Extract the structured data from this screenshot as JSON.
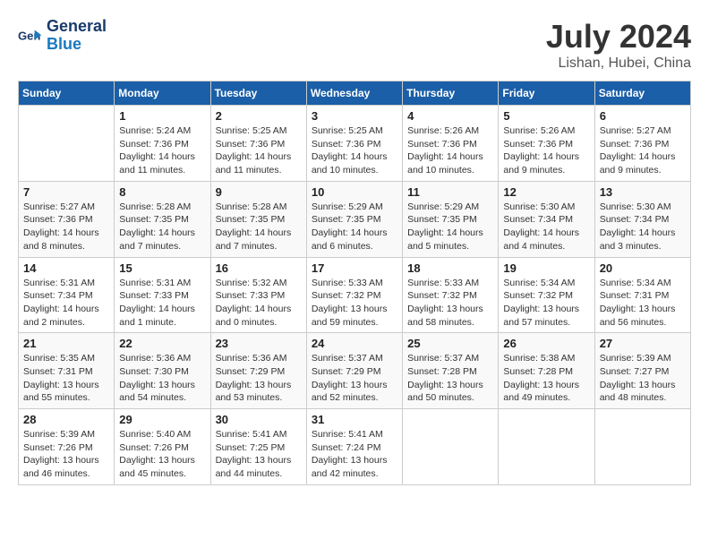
{
  "header": {
    "logo_line1": "General",
    "logo_line2": "Blue",
    "month_title": "July 2024",
    "location": "Lishan, Hubei, China"
  },
  "days_of_week": [
    "Sunday",
    "Monday",
    "Tuesday",
    "Wednesday",
    "Thursday",
    "Friday",
    "Saturday"
  ],
  "weeks": [
    [
      {
        "day": "",
        "info": ""
      },
      {
        "day": "1",
        "info": "Sunrise: 5:24 AM\nSunset: 7:36 PM\nDaylight: 14 hours\nand 11 minutes."
      },
      {
        "day": "2",
        "info": "Sunrise: 5:25 AM\nSunset: 7:36 PM\nDaylight: 14 hours\nand 11 minutes."
      },
      {
        "day": "3",
        "info": "Sunrise: 5:25 AM\nSunset: 7:36 PM\nDaylight: 14 hours\nand 10 minutes."
      },
      {
        "day": "4",
        "info": "Sunrise: 5:26 AM\nSunset: 7:36 PM\nDaylight: 14 hours\nand 10 minutes."
      },
      {
        "day": "5",
        "info": "Sunrise: 5:26 AM\nSunset: 7:36 PM\nDaylight: 14 hours\nand 9 minutes."
      },
      {
        "day": "6",
        "info": "Sunrise: 5:27 AM\nSunset: 7:36 PM\nDaylight: 14 hours\nand 9 minutes."
      }
    ],
    [
      {
        "day": "7",
        "info": "Sunrise: 5:27 AM\nSunset: 7:36 PM\nDaylight: 14 hours\nand 8 minutes."
      },
      {
        "day": "8",
        "info": "Sunrise: 5:28 AM\nSunset: 7:35 PM\nDaylight: 14 hours\nand 7 minutes."
      },
      {
        "day": "9",
        "info": "Sunrise: 5:28 AM\nSunset: 7:35 PM\nDaylight: 14 hours\nand 7 minutes."
      },
      {
        "day": "10",
        "info": "Sunrise: 5:29 AM\nSunset: 7:35 PM\nDaylight: 14 hours\nand 6 minutes."
      },
      {
        "day": "11",
        "info": "Sunrise: 5:29 AM\nSunset: 7:35 PM\nDaylight: 14 hours\nand 5 minutes."
      },
      {
        "day": "12",
        "info": "Sunrise: 5:30 AM\nSunset: 7:34 PM\nDaylight: 14 hours\nand 4 minutes."
      },
      {
        "day": "13",
        "info": "Sunrise: 5:30 AM\nSunset: 7:34 PM\nDaylight: 14 hours\nand 3 minutes."
      }
    ],
    [
      {
        "day": "14",
        "info": "Sunrise: 5:31 AM\nSunset: 7:34 PM\nDaylight: 14 hours\nand 2 minutes."
      },
      {
        "day": "15",
        "info": "Sunrise: 5:31 AM\nSunset: 7:33 PM\nDaylight: 14 hours\nand 1 minute."
      },
      {
        "day": "16",
        "info": "Sunrise: 5:32 AM\nSunset: 7:33 PM\nDaylight: 14 hours\nand 0 minutes."
      },
      {
        "day": "17",
        "info": "Sunrise: 5:33 AM\nSunset: 7:32 PM\nDaylight: 13 hours\nand 59 minutes."
      },
      {
        "day": "18",
        "info": "Sunrise: 5:33 AM\nSunset: 7:32 PM\nDaylight: 13 hours\nand 58 minutes."
      },
      {
        "day": "19",
        "info": "Sunrise: 5:34 AM\nSunset: 7:32 PM\nDaylight: 13 hours\nand 57 minutes."
      },
      {
        "day": "20",
        "info": "Sunrise: 5:34 AM\nSunset: 7:31 PM\nDaylight: 13 hours\nand 56 minutes."
      }
    ],
    [
      {
        "day": "21",
        "info": "Sunrise: 5:35 AM\nSunset: 7:31 PM\nDaylight: 13 hours\nand 55 minutes."
      },
      {
        "day": "22",
        "info": "Sunrise: 5:36 AM\nSunset: 7:30 PM\nDaylight: 13 hours\nand 54 minutes."
      },
      {
        "day": "23",
        "info": "Sunrise: 5:36 AM\nSunset: 7:29 PM\nDaylight: 13 hours\nand 53 minutes."
      },
      {
        "day": "24",
        "info": "Sunrise: 5:37 AM\nSunset: 7:29 PM\nDaylight: 13 hours\nand 52 minutes."
      },
      {
        "day": "25",
        "info": "Sunrise: 5:37 AM\nSunset: 7:28 PM\nDaylight: 13 hours\nand 50 minutes."
      },
      {
        "day": "26",
        "info": "Sunrise: 5:38 AM\nSunset: 7:28 PM\nDaylight: 13 hours\nand 49 minutes."
      },
      {
        "day": "27",
        "info": "Sunrise: 5:39 AM\nSunset: 7:27 PM\nDaylight: 13 hours\nand 48 minutes."
      }
    ],
    [
      {
        "day": "28",
        "info": "Sunrise: 5:39 AM\nSunset: 7:26 PM\nDaylight: 13 hours\nand 46 minutes."
      },
      {
        "day": "29",
        "info": "Sunrise: 5:40 AM\nSunset: 7:26 PM\nDaylight: 13 hours\nand 45 minutes."
      },
      {
        "day": "30",
        "info": "Sunrise: 5:41 AM\nSunset: 7:25 PM\nDaylight: 13 hours\nand 44 minutes."
      },
      {
        "day": "31",
        "info": "Sunrise: 5:41 AM\nSunset: 7:24 PM\nDaylight: 13 hours\nand 42 minutes."
      },
      {
        "day": "",
        "info": ""
      },
      {
        "day": "",
        "info": ""
      },
      {
        "day": "",
        "info": ""
      }
    ]
  ]
}
